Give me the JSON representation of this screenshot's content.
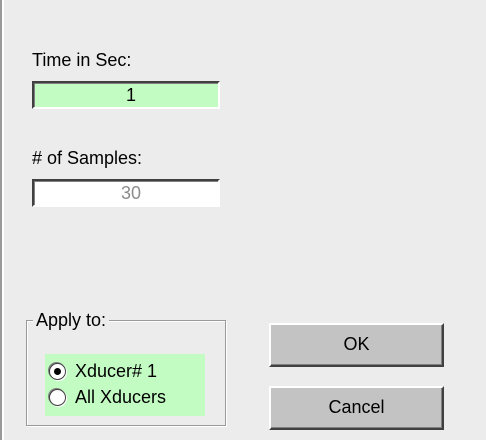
{
  "form": {
    "time_label": "Time in Sec:",
    "time_value": "1",
    "samples_label": "# of Samples:",
    "samples_value": "30"
  },
  "apply_to": {
    "title": "Apply to:",
    "options": [
      {
        "label": "Xducer# 1",
        "selected": true
      },
      {
        "label": "All Xducers",
        "selected": false
      }
    ]
  },
  "buttons": {
    "ok_label": "OK",
    "cancel_label": "Cancel"
  },
  "colors": {
    "field_highlight": "#c3fcc3",
    "dialog_background": "#ececec",
    "button_face": "#c3c3c3",
    "disabled_text": "#8c8c8c"
  }
}
